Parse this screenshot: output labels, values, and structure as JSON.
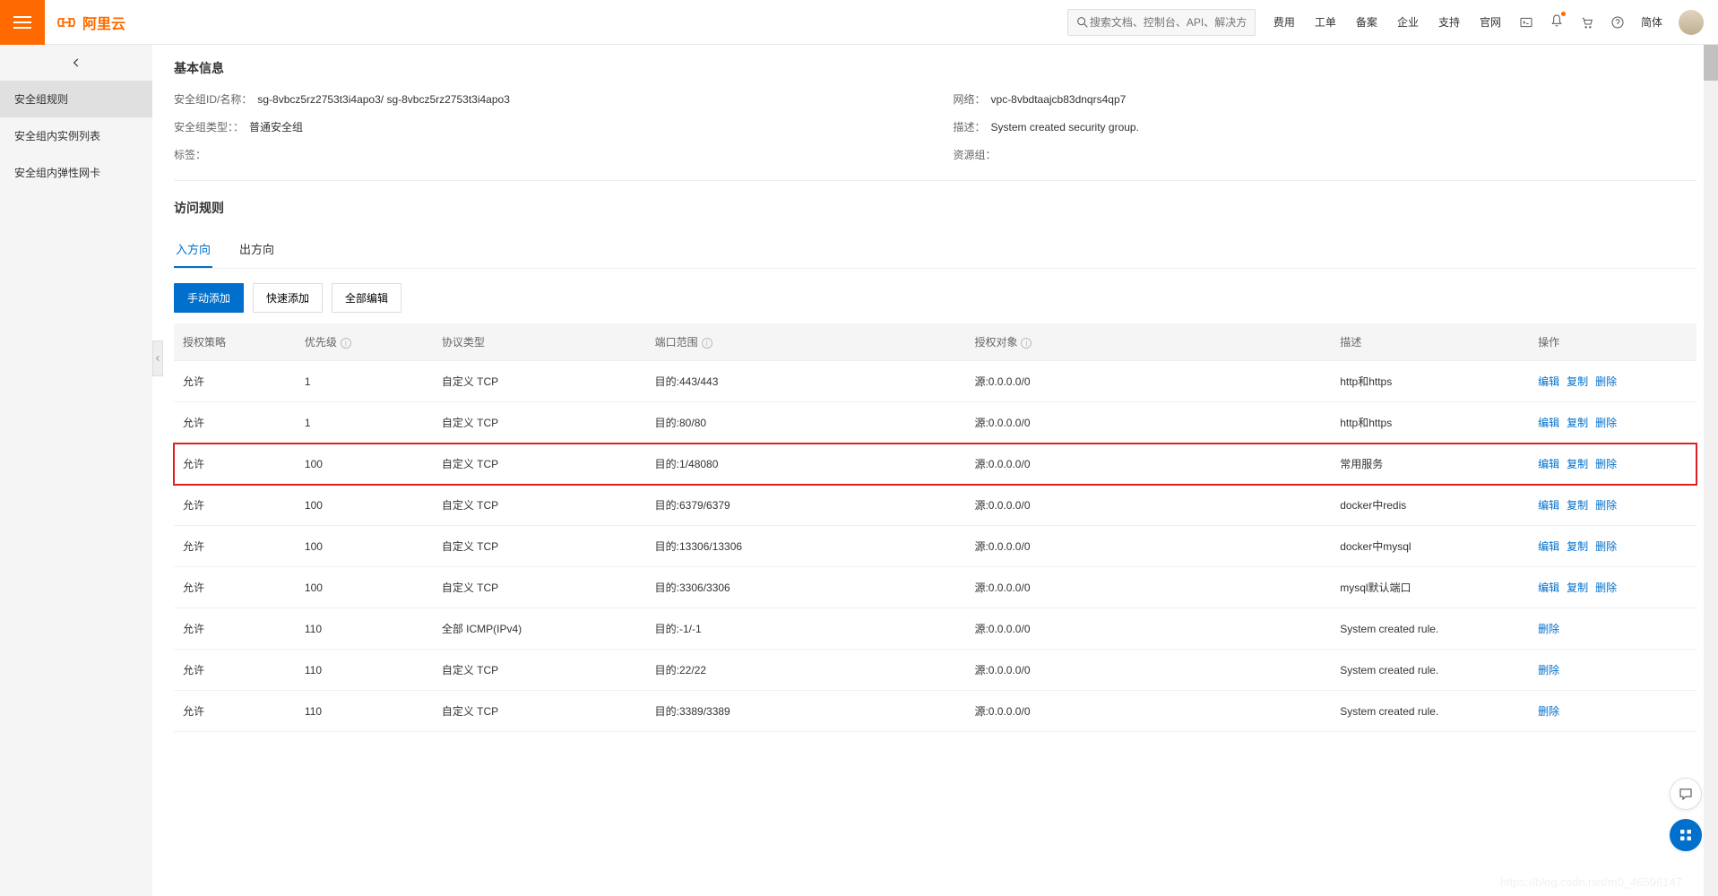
{
  "header": {
    "brand": "阿里云",
    "search_placeholder": "搜索文档、控制台、API、解决方案和资源",
    "nav": [
      "费用",
      "工单",
      "备案",
      "企业",
      "支持",
      "官网"
    ],
    "lang": "简体"
  },
  "sidebar": {
    "items": [
      "安全组规则",
      "安全组内实例列表",
      "安全组内弹性网卡"
    ]
  },
  "basic": {
    "title": "基本信息",
    "fields": {
      "sg_id_label": "安全组ID/名称：",
      "sg_id_value": "sg-8vbcz5rz2753t3i4apo3/ sg-8vbcz5rz2753t3i4apo3",
      "network_label": "网络：",
      "network_value": "vpc-8vbdtaajcb83dnqrs4qp7",
      "sg_type_label": "安全组类型：：",
      "sg_type_value": "普通安全组",
      "desc_label": "描述：",
      "desc_value": "System created security group.",
      "tags_label": "标签：",
      "tags_value": "",
      "resgroup_label": "资源组：",
      "resgroup_value": ""
    }
  },
  "rules": {
    "title": "访问规则",
    "tabs": {
      "inbound": "入方向",
      "outbound": "出方向"
    },
    "buttons": {
      "manual": "手动添加",
      "quick": "快速添加",
      "editall": "全部编辑"
    },
    "columns": {
      "policy": "授权策略",
      "priority": "优先级",
      "protocol": "协议类型",
      "port": "端口范围",
      "object": "授权对象",
      "desc": "描述",
      "ops": "操作"
    },
    "actions": {
      "edit": "编辑",
      "copy": "复制",
      "delete": "删除"
    },
    "rows": [
      {
        "policy": "允许",
        "priority": "1",
        "protocol": "自定义 TCP",
        "port": "目的:443/443",
        "object": "源:0.0.0.0/0",
        "desc": "http和https",
        "ops": [
          "edit",
          "copy",
          "delete"
        ],
        "hl": false
      },
      {
        "policy": "允许",
        "priority": "1",
        "protocol": "自定义 TCP",
        "port": "目的:80/80",
        "object": "源:0.0.0.0/0",
        "desc": "http和https",
        "ops": [
          "edit",
          "copy",
          "delete"
        ],
        "hl": false
      },
      {
        "policy": "允许",
        "priority": "100",
        "protocol": "自定义 TCP",
        "port": "目的:1/48080",
        "object": "源:0.0.0.0/0",
        "desc": "常用服务",
        "ops": [
          "edit",
          "copy",
          "delete"
        ],
        "hl": true
      },
      {
        "policy": "允许",
        "priority": "100",
        "protocol": "自定义 TCP",
        "port": "目的:6379/6379",
        "object": "源:0.0.0.0/0",
        "desc": "docker中redis",
        "ops": [
          "edit",
          "copy",
          "delete"
        ],
        "hl": false
      },
      {
        "policy": "允许",
        "priority": "100",
        "protocol": "自定义 TCP",
        "port": "目的:13306/13306",
        "object": "源:0.0.0.0/0",
        "desc": "docker中mysql",
        "ops": [
          "edit",
          "copy",
          "delete"
        ],
        "hl": false
      },
      {
        "policy": "允许",
        "priority": "100",
        "protocol": "自定义 TCP",
        "port": "目的:3306/3306",
        "object": "源:0.0.0.0/0",
        "desc": "mysql默认端口",
        "ops": [
          "edit",
          "copy",
          "delete"
        ],
        "hl": false
      },
      {
        "policy": "允许",
        "priority": "110",
        "protocol": "全部 ICMP(IPv4)",
        "port": "目的:-1/-1",
        "object": "源:0.0.0.0/0",
        "desc": "System created rule.",
        "ops": [
          "delete"
        ],
        "hl": false
      },
      {
        "policy": "允许",
        "priority": "110",
        "protocol": "自定义 TCP",
        "port": "目的:22/22",
        "object": "源:0.0.0.0/0",
        "desc": "System created rule.",
        "ops": [
          "delete"
        ],
        "hl": false
      },
      {
        "policy": "允许",
        "priority": "110",
        "protocol": "自定义 TCP",
        "port": "目的:3389/3389",
        "object": "源:0.0.0.0/0",
        "desc": "System created rule.",
        "ops": [
          "delete"
        ],
        "hl": false
      }
    ]
  },
  "watermark": "https://blog.csdn.net/m0_46596147"
}
